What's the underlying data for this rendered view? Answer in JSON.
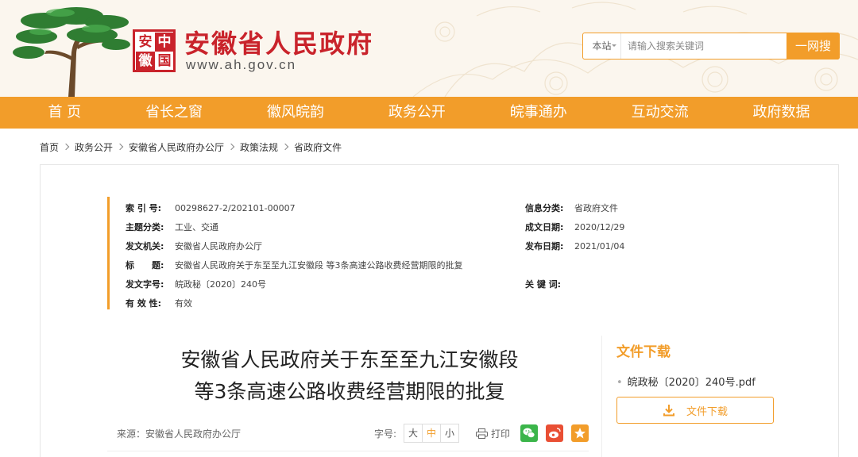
{
  "header": {
    "seal": [
      "安",
      "中",
      "徽",
      "国"
    ],
    "site_name": "安徽省人民政府",
    "site_url": "www.ah.gov.cn",
    "search": {
      "scope": "本站",
      "placeholder": "请输入搜索关键词",
      "button": "一网搜"
    }
  },
  "nav": {
    "items": [
      {
        "label": "首 页"
      },
      {
        "label": "省长之窗"
      },
      {
        "label": "徽风皖韵"
      },
      {
        "label": "政务公开"
      },
      {
        "label": "皖事通办"
      },
      {
        "label": "互动交流"
      },
      {
        "label": "政府数据"
      }
    ]
  },
  "breadcrumb": [
    "首页",
    "政务公开",
    "安徽省人民政府办公厅",
    "政策法规",
    "省政府文件"
  ],
  "meta": {
    "index_no": {
      "k": "索 引 号:",
      "v": "00298627-2/202101-00007"
    },
    "category_info": {
      "k": "信息分类:",
      "v": "省政府文件"
    },
    "topic": {
      "k": "主题分类:",
      "v": "工业、交通"
    },
    "created": {
      "k": "成文日期:",
      "v": "2020/12/29"
    },
    "issuer": {
      "k": "发文机关:",
      "v": "安徽省人民政府办公厅"
    },
    "published": {
      "k": "发布日期:",
      "v": "2021/01/04"
    },
    "title": {
      "k": "标　　题:",
      "v": "安徽省人民政府关于东至至九江安徽段 等3条高速公路收费经营期限的批复"
    },
    "doc_no": {
      "k": "发文字号:",
      "v": "皖政秘〔2020〕240号"
    },
    "keywords": {
      "k": "关 键 词:",
      "v": ""
    },
    "validity": {
      "k": "有 效 性:",
      "v": "有效"
    }
  },
  "article": {
    "title_line1": "安徽省人民政府关于东至至九江安徽段",
    "title_line2": "等3条高速公路收费经营期限的批复",
    "source": "来源：安徽省人民政府办公厅",
    "font_size_label": "字号:",
    "font_sizes": [
      "大",
      "中",
      "小"
    ],
    "print_label": "打印"
  },
  "download": {
    "title": "文件下载",
    "file_name": "皖政秘〔2020〕240号.pdf",
    "button": "文件下载"
  },
  "colors": {
    "brand_red": "#c9232b",
    "accent_orange": "#f29d2a",
    "wechat_green": "#3bb54a",
    "weibo_red": "#e94f34"
  }
}
